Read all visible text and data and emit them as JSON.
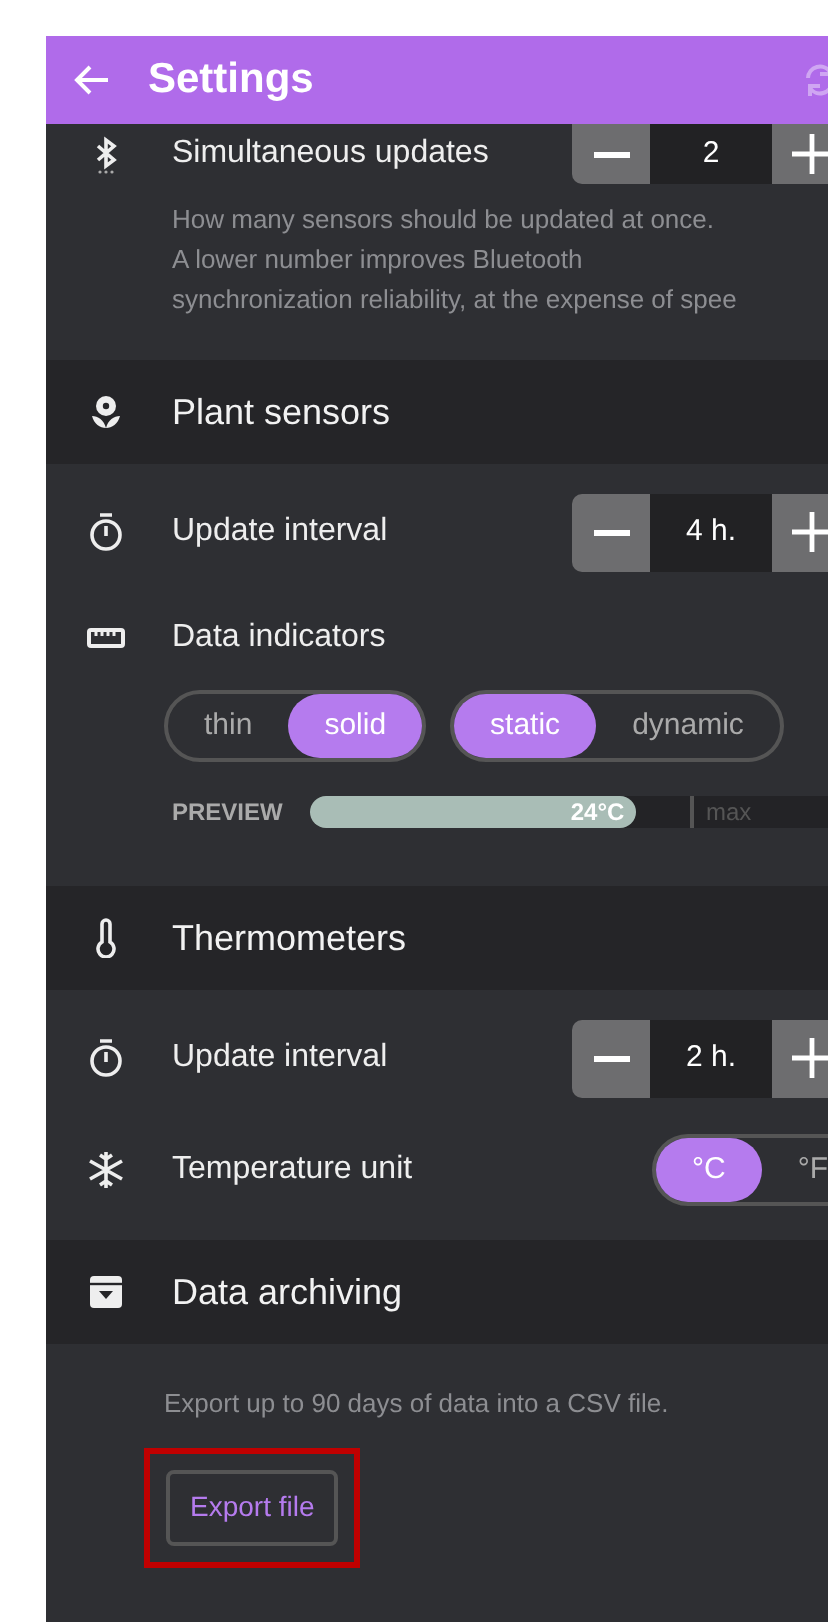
{
  "app_bar": {
    "title": "Settings"
  },
  "items": [
    {
      "kind": "stepper",
      "label": "Simultaneous updates",
      "value": "2",
      "description": "How many sensors should be updated at once.\nA lower number improves Bluetooth\nsynchronization reliability, at the expense of spee"
    },
    {
      "kind": "header",
      "label": "Plant sensors"
    },
    {
      "kind": "stepper",
      "label": "Update interval",
      "value": "4 h."
    },
    {
      "kind": "indicators",
      "label": "Data indicators",
      "toggle_groups": [
        [
          {
            "label": "thin",
            "selected": false
          },
          {
            "label": "solid",
            "selected": true
          }
        ],
        [
          {
            "label": "static",
            "selected": true
          },
          {
            "label": "dynamic",
            "selected": false
          }
        ]
      ],
      "preview": {
        "label": "PREVIEW",
        "value": "24°C",
        "level": 0.63,
        "max": "max"
      }
    },
    {
      "kind": "header",
      "label": "Thermometers"
    },
    {
      "kind": "stepper",
      "label": "Update interval",
      "value": "2 h."
    },
    {
      "kind": "segmented",
      "label": "Temperature unit",
      "options": [
        {
          "label": "°C",
          "selected": true
        },
        {
          "label": "°F",
          "selected": false
        }
      ]
    },
    {
      "kind": "header",
      "label": "Data archiving"
    },
    {
      "kind": "export",
      "description": "Export up to 90 days of data into a CSV file.",
      "button": {
        "label": "Export file",
        "highlighted": true
      }
    }
  ]
}
